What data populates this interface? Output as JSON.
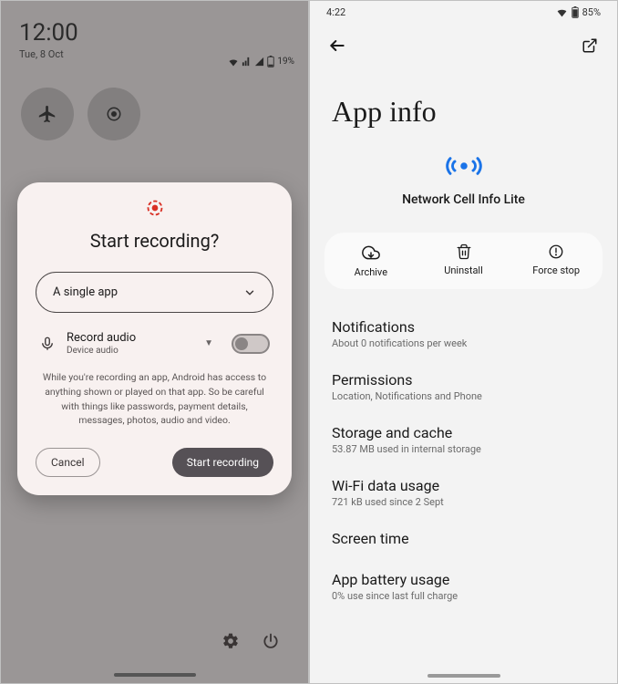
{
  "left": {
    "status": {
      "clock": "12:00",
      "date": "Tue, 8 Oct",
      "battery": "19%"
    },
    "dialog": {
      "title": "Start recording?",
      "dropdown_value": "A single app",
      "audio_label": "Record audio",
      "audio_sub": "Device audio",
      "disclaimer": "While you're recording an app, Android has access to anything shown or played on that app. So be careful with things like passwords, payment details, messages, photos, audio and video.",
      "cancel": "Cancel",
      "start": "Start recording"
    }
  },
  "right": {
    "status": {
      "clock": "4:22",
      "battery": "85%"
    },
    "page_title": "App info",
    "app_name": "Network Cell Info Lite",
    "actions": {
      "archive": "Archive",
      "uninstall": "Uninstall",
      "force_stop": "Force stop"
    },
    "settings": {
      "notifications": {
        "title": "Notifications",
        "sub": "About 0 notifications per week"
      },
      "permissions": {
        "title": "Permissions",
        "sub": "Location, Notifications and Phone"
      },
      "storage": {
        "title": "Storage and cache",
        "sub": "53.87 MB used in internal storage"
      },
      "wifi": {
        "title": "Wi-Fi data usage",
        "sub": "721 kB used since 2 Sept"
      },
      "screen_time": {
        "title": "Screen time"
      },
      "battery": {
        "title": "App battery usage",
        "sub": "0% use since last full charge"
      }
    }
  }
}
